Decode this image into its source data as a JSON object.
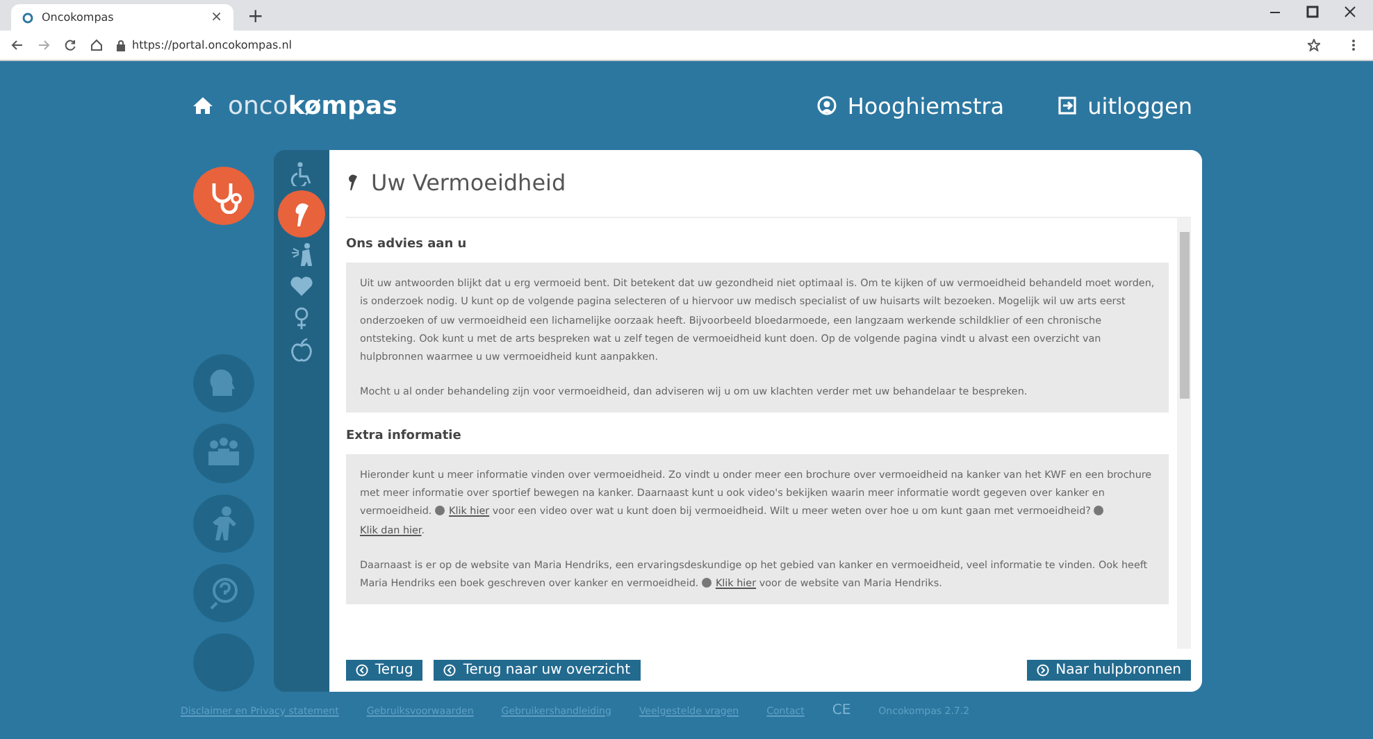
{
  "browser": {
    "tab_title": "Oncokompas",
    "tab_close": "×",
    "new_tab": "+",
    "url": "https://portal.oncokompas.nl"
  },
  "header": {
    "logo_light": "onco",
    "logo_bold": "kømpas",
    "user": "Hooghiemstra",
    "logout": "uitloggen"
  },
  "domains": [
    {
      "kind": "stethoscope",
      "selected": true
    },
    {
      "kind": "head",
      "selected": false
    },
    {
      "kind": "people",
      "selected": false
    },
    {
      "kind": "person",
      "selected": false
    },
    {
      "kind": "question",
      "selected": false
    },
    {
      "kind": "blank",
      "selected": false
    }
  ],
  "topics": [
    {
      "kind": "wheelchair",
      "selected": false
    },
    {
      "kind": "fatigue",
      "selected": true
    },
    {
      "kind": "pain",
      "selected": false
    },
    {
      "kind": "heart",
      "selected": false
    },
    {
      "kind": "female",
      "selected": false
    },
    {
      "kind": "apple",
      "selected": false
    }
  ],
  "page_title": "Uw Vermoeidheid",
  "sections": [
    {
      "heading": "Ons advies aan u",
      "paragraphs": [
        [
          {
            "kind": "text",
            "text": "Uit uw antwoorden blijkt dat u erg vermoeid bent. Dit betekent dat uw gezondheid niet optimaal is. Om te kijken of uw vermoeidheid behandeld moet worden, is onderzoek nodig. U kunt op de volgende pagina selecteren of u hiervoor uw medisch specialist of uw huisarts wilt bezoeken. Mogelijk wil uw arts eerst onderzoeken of uw vermoeidheid een lichamelijke oorzaak heeft. Bijvoorbeeld bloedarmoede, een langzaam werkende schildklier of een chronische ontsteking. Ook kunt u met de arts bespreken wat u zelf tegen de vermoeidheid kunt doen. Op de volgende pagina vindt u alvast een overzicht van hulpbronnen waarmee u uw vermoeidheid kunt aanpakken."
          }
        ],
        [
          {
            "kind": "text",
            "text": "Mocht u al onder behandeling zijn voor vermoeidheid, dan adviseren wij u om uw klachten verder met uw behandelaar te bespreken."
          }
        ]
      ]
    },
    {
      "heading": "Extra informatie",
      "paragraphs": [
        [
          {
            "kind": "text",
            "text": "Hieronder kunt u meer informatie vinden over vermoeidheid. Zo vindt u onder meer een brochure over vermoeidheid na kanker van het KWF en een brochure met meer informatie over sportief bewegen na kanker. Daarnaast kunt u ook video's bekijken waarin meer informatie wordt gegeven over kanker en vermoeidheid. "
          },
          {
            "kind": "link",
            "text": "Klik hier"
          },
          {
            "kind": "text",
            "text": " voor een video over wat u kunt doen bij vermoeidheid. Wilt u meer weten over hoe u om kunt gaan met vermoeidheid? "
          },
          {
            "kind": "link",
            "text": "Klik dan hier"
          },
          {
            "kind": "text",
            "text": "."
          }
        ],
        [
          {
            "kind": "text",
            "text": "Daarnaast is er op de website van Maria Hendriks, een ervaringsdeskundige op het gebied van kanker en vermoeidheid, veel informatie te vinden. Ook heeft Maria Hendriks een boek geschreven over kanker en vermoeidheid. "
          },
          {
            "kind": "link",
            "text": "Klik hier"
          },
          {
            "kind": "text",
            "text": " voor de website van Maria Hendriks."
          }
        ]
      ]
    }
  ],
  "buttons": [
    {
      "label": "Terug",
      "kind": "back"
    },
    {
      "label": "Terug naar uw overzicht",
      "kind": "back"
    },
    {
      "label": "Naar hulpbronnen",
      "kind": "forward"
    }
  ],
  "footer": {
    "links": [
      "Disclaimer en Privacy statement",
      "Gebruiksvoorwaarden",
      "Gebruikershandleiding",
      "Veelgestelde vragen",
      "Contact"
    ],
    "ce": "CE",
    "version": "Oncokompas 2.7.2"
  }
}
